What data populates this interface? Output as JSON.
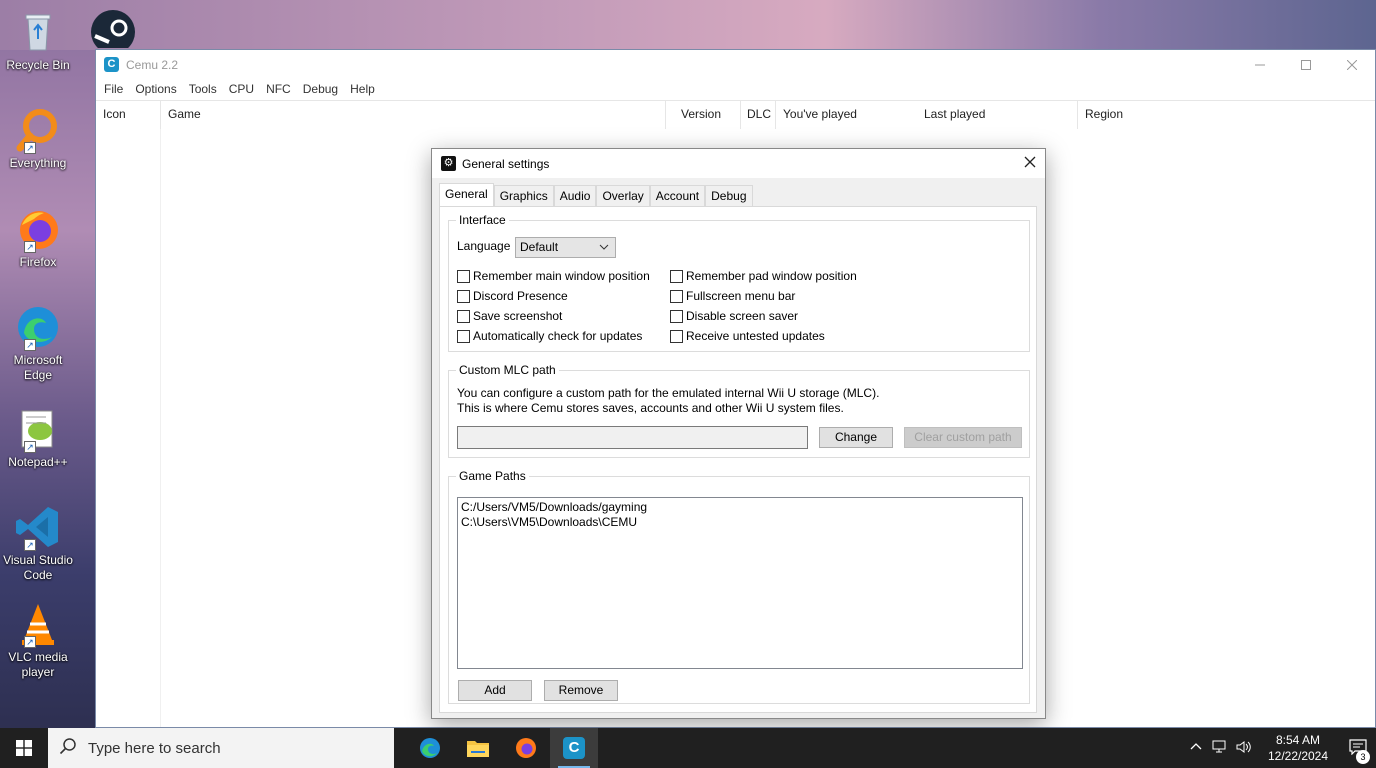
{
  "desktop": {
    "icons": [
      {
        "label": "Recycle Bin",
        "icon": "recycle-bin-icon"
      },
      {
        "label": "Everything",
        "icon": "everything-search-icon"
      },
      {
        "label": "Firefox",
        "icon": "firefox-icon"
      },
      {
        "label": "Microsoft Edge",
        "icon": "edge-icon"
      },
      {
        "label": "Notepad++",
        "icon": "notepadpp-icon"
      },
      {
        "label": "Visual Studio Code",
        "icon": "vscode-icon"
      },
      {
        "label": "VLC media player",
        "icon": "vlc-icon"
      }
    ]
  },
  "cemu": {
    "title": "Cemu 2.2",
    "menu": [
      "File",
      "Options",
      "Tools",
      "CPU",
      "NFC",
      "Debug",
      "Help"
    ],
    "columns": [
      "Icon",
      "Game",
      "Version",
      "DLC",
      "You've played",
      "Last played",
      "Region"
    ]
  },
  "dialog": {
    "title": "General settings",
    "close": "✕",
    "tabs": [
      "General",
      "Graphics",
      "Audio",
      "Overlay",
      "Account",
      "Debug"
    ],
    "interface": {
      "label": "Interface",
      "language_label": "Language",
      "language_value": "Default",
      "checkboxes_left": [
        "Remember main window position",
        "Discord Presence",
        "Save screenshot",
        "Automatically check for updates"
      ],
      "checkboxes_right": [
        "Remember pad window position",
        "Fullscreen menu bar",
        "Disable screen saver",
        "Receive untested updates"
      ]
    },
    "mlc": {
      "label": "Custom MLC path",
      "desc1": "You can configure a custom path for the emulated internal Wii U storage (MLC).",
      "desc2": "This is where Cemu stores saves, accounts and other Wii U system files.",
      "path_value": "",
      "change": "Change",
      "clear": "Clear custom path"
    },
    "game_paths": {
      "label": "Game Paths",
      "items": [
        "C:/Users/VM5/Downloads/gayming",
        "C:\\Users\\VM5\\Downloads\\CEMU"
      ],
      "add": "Add",
      "remove": "Remove"
    }
  },
  "taskbar": {
    "search_placeholder": "Type here to search",
    "time": "8:54 AM",
    "date": "12/22/2024",
    "notification_count": "3"
  },
  "colors": {
    "taskbar": "#202020",
    "accent": "#76b9ed",
    "cemu_icon": "#1c93c8"
  }
}
